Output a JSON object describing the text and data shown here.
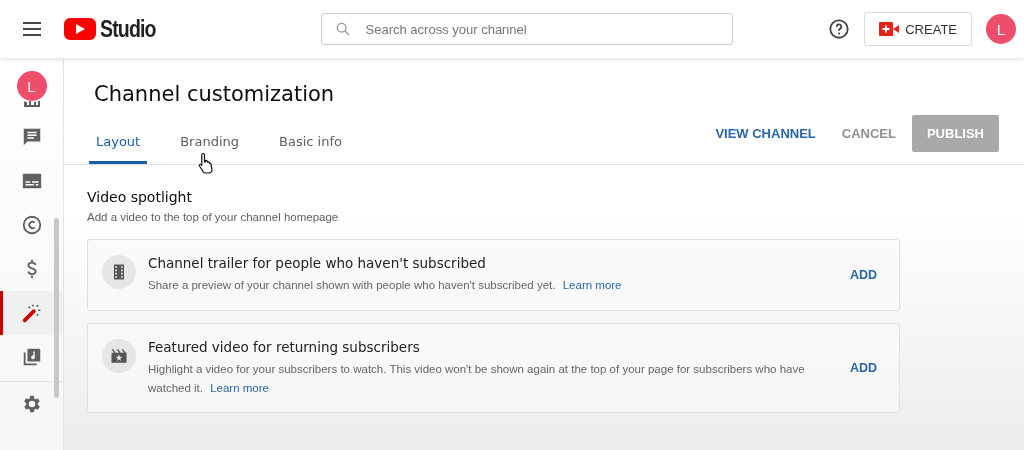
{
  "header": {
    "brand": "Studio",
    "search": {
      "placeholder": "Search across your channel"
    },
    "create": "CREATE",
    "avatar": "L"
  },
  "sidebar": {
    "avatar": "L",
    "items": [
      {
        "kind": "analytics",
        "selected": false
      },
      {
        "kind": "comments",
        "selected": false
      },
      {
        "kind": "subtitles",
        "selected": false
      },
      {
        "kind": "copyright",
        "selected": false
      },
      {
        "kind": "earn",
        "selected": false
      },
      {
        "kind": "customization",
        "selected": true
      },
      {
        "kind": "audio-library",
        "selected": false
      }
    ],
    "bottom": [
      {
        "kind": "settings",
        "selected": false
      }
    ]
  },
  "page": {
    "title": "Channel customization",
    "tabs": [
      {
        "label": "Layout",
        "selected": true
      },
      {
        "label": "Branding",
        "selected": false
      },
      {
        "label": "Basic info",
        "selected": false
      }
    ],
    "actions": [
      {
        "label": "VIEW CHANNEL",
        "kind": "link",
        "disabled": false
      },
      {
        "label": "CANCEL",
        "kind": "text",
        "disabled": false
      },
      {
        "label": "PUBLISH",
        "kind": "filled",
        "disabled": true
      }
    ],
    "section": {
      "title": "Video spotlight",
      "description": "Add a video to the top of your channel homepage",
      "cards": [
        {
          "kind": "trailer",
          "title": "Channel trailer for people who haven't subscribed",
          "text": "Share a preview of your channel shown with people who haven't subscribed yet.",
          "link": "Learn more",
          "action": "ADD"
        },
        {
          "kind": "featured",
          "title": "Featured video for returning subscribers",
          "text": "Highlight a video for your subscribers to watch. This video won't be shown again at the top of your page for subscribers who have watched it.",
          "link": "Learn more",
          "action": "ADD"
        }
      ]
    }
  }
}
